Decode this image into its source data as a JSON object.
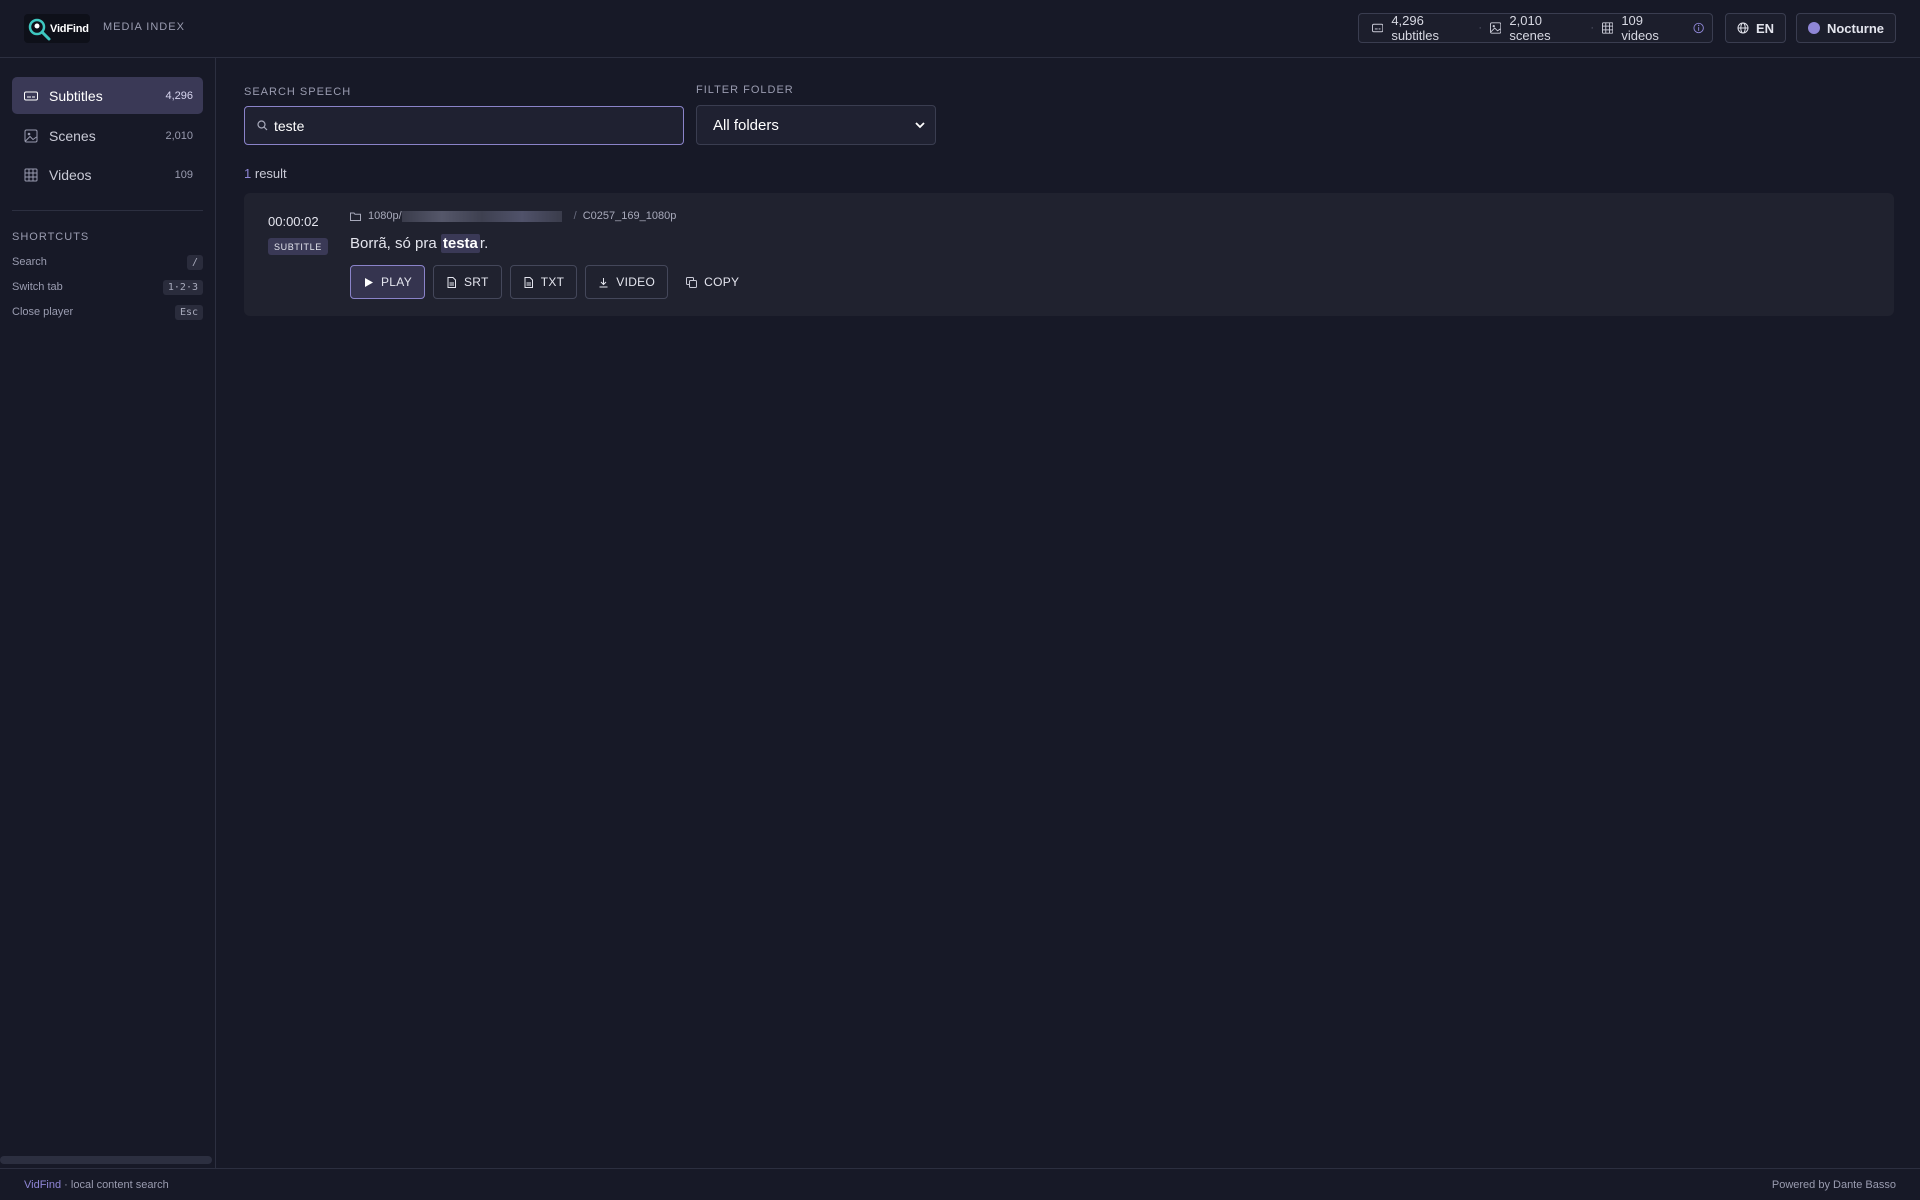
{
  "header": {
    "logo_text": "VidFind",
    "section_label": "MEDIA INDEX",
    "stats": {
      "subtitles": "4,296 subtitles",
      "scenes": "2,010 scenes",
      "videos": "109 videos"
    },
    "language": "EN",
    "theme": "Nocturne"
  },
  "sidebar": {
    "items": [
      {
        "label": "Subtitles",
        "count": "4,296",
        "icon": "subtitles-icon"
      },
      {
        "label": "Scenes",
        "count": "2,010",
        "icon": "image-icon"
      },
      {
        "label": "Videos",
        "count": "109",
        "icon": "grid-icon"
      }
    ],
    "shortcuts_title": "SHORTCUTS",
    "shortcuts": [
      {
        "label": "Search",
        "key": "/"
      },
      {
        "label": "Switch tab",
        "key": "1·2·3"
      },
      {
        "label": "Close player",
        "key": "Esc"
      }
    ]
  },
  "search": {
    "label": "SEARCH SPEECH",
    "value": "teste"
  },
  "filter": {
    "label": "FILTER FOLDER",
    "selected": "All folders"
  },
  "results": {
    "count": "1",
    "count_suffix": "result",
    "items": [
      {
        "timecode": "00:00:02",
        "type": "SUBTITLE",
        "path_prefix": "1080p/",
        "file": "C0257_169_1080p",
        "text_before": "Borrã, só pra ",
        "text_highlight": "testa",
        "text_after": "r.",
        "actions": {
          "play": "PLAY",
          "srt": "SRT",
          "txt": "TXT",
          "video": "VIDEO",
          "copy": "COPY"
        }
      }
    ]
  },
  "footer": {
    "brand": "VidFind",
    "tagline": " · local content search",
    "credit": "Powered by Dante Basso"
  },
  "colors": {
    "background": "#171927",
    "accent": "#8f86d6",
    "active_item": "#3a3956"
  }
}
